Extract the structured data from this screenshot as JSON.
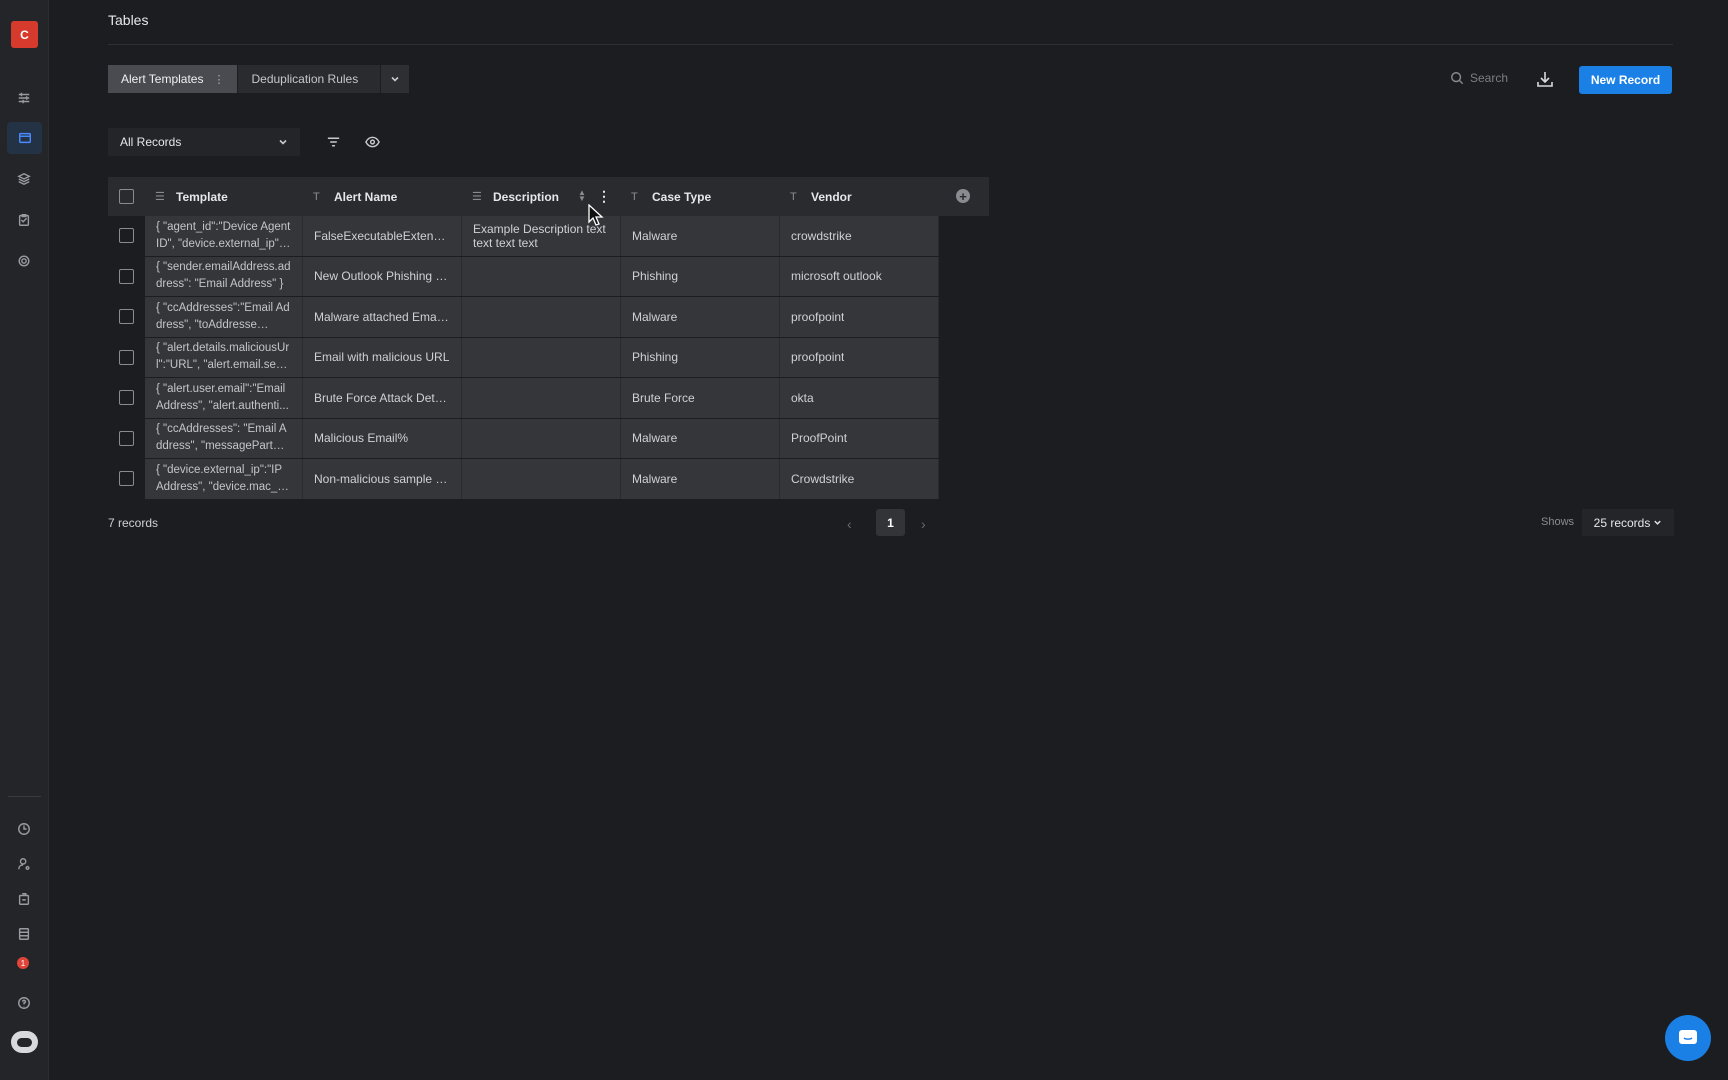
{
  "app": {
    "logo_letter": "C",
    "page_title": "Tables"
  },
  "sidebar": {
    "top_items": [
      {
        "icon": "sliders-icon"
      },
      {
        "icon": "table-icon",
        "active": true
      },
      {
        "icon": "layers-icon"
      },
      {
        "icon": "clipboard-icon"
      },
      {
        "icon": "gear-icon"
      }
    ],
    "bottom_items": [
      {
        "icon": "clock-icon"
      },
      {
        "icon": "user-settings-icon"
      },
      {
        "icon": "package-icon"
      },
      {
        "icon": "database-icon"
      },
      {
        "icon": "notification-icon",
        "badge": "1"
      },
      {
        "icon": "help-icon"
      },
      {
        "icon": "bot-icon"
      }
    ]
  },
  "tabs": {
    "items": [
      {
        "label": "Alert Templates",
        "active": true
      },
      {
        "label": "Deduplication Rules",
        "active": false
      }
    ]
  },
  "toolbar": {
    "search_placeholder": "Search",
    "new_record_label": "New Record"
  },
  "view": {
    "selected": "All Records"
  },
  "table": {
    "columns": [
      {
        "label": "Template",
        "type_icon": "long-text-icon"
      },
      {
        "label": "Alert Name",
        "type_icon": "text-icon"
      },
      {
        "label": "Description",
        "type_icon": "long-text-icon"
      },
      {
        "label": "Case Type",
        "type_icon": "text-icon"
      },
      {
        "label": "Vendor",
        "type_icon": "text-icon"
      }
    ],
    "rows": [
      {
        "template": "{ \"agent_id\":\"Device Agent ID\", \"device.external_ip\": …",
        "alert_name": "FalseExecutableExtension",
        "description": "Example Description text text text text",
        "case_type": "Malware",
        "vendor": "crowdstrike"
      },
      {
        "template": "{ \"sender.emailAddress.address\": \"Email Address\" }",
        "alert_name": "New Outlook Phishing R...",
        "description": "",
        "case_type": "Phishing",
        "vendor": "microsoft outlook"
      },
      {
        "template": "{ \"ccAddresses\":\"Email Address\", \"toAddresses\":\"E...",
        "alert_name": "Malware attached Email%",
        "description": "",
        "case_type": "Malware",
        "vendor": "proofpoint"
      },
      {
        "template": "{ \"alert.details.maliciousUrl\":\"URL\", \"alert.email.sen...",
        "alert_name": "Email with malicious URL",
        "description": "",
        "case_type": "Phishing",
        "vendor": "proofpoint"
      },
      {
        "template": "{ \"alert.user.email\":\"Email Address\", \"alert.authenti...",
        "alert_name": "Brute Force Attack Dete...",
        "description": "",
        "case_type": "Brute Force",
        "vendor": "okta"
      },
      {
        "template": "{ \"ccAddresses\": \"Email Address\", \"messageParts....",
        "alert_name": "Malicious Email%",
        "description": "",
        "case_type": "Malware",
        "vendor": "ProofPoint"
      },
      {
        "template": "{ \"device.external_ip\":\"IP Address\", \"device.mac_ad...",
        "alert_name": "Non-malicious sample d...",
        "description": "",
        "case_type": "Malware",
        "vendor": "Crowdstrike"
      }
    ]
  },
  "footer": {
    "records_count": "7 records",
    "current_page": "1",
    "shows_label": "Shows",
    "per_page": "25 records"
  }
}
